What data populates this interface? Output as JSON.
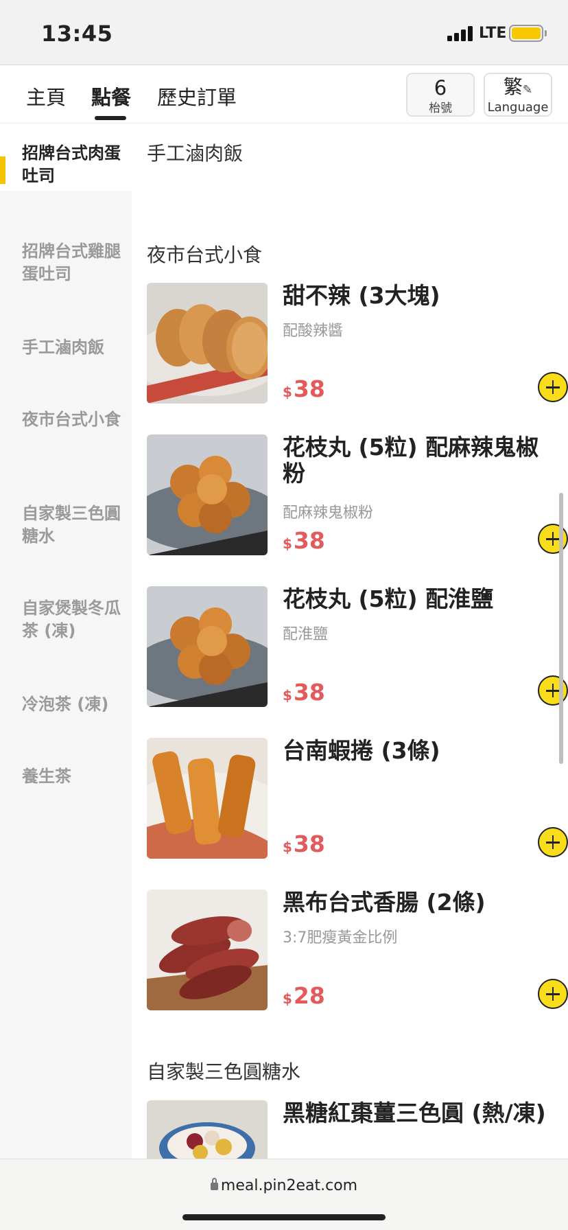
{
  "status_bar": {
    "time": "13:45",
    "network": "LTE"
  },
  "nav": {
    "tabs": [
      "主頁",
      "點餐",
      "歷史訂單"
    ],
    "active_tab": "點餐",
    "table_number": "6",
    "table_label": "枱號",
    "lang_char": "繁",
    "lang_label": "Language"
  },
  "sidebar": {
    "active": "招牌台式肉蛋吐司",
    "items": [
      {
        "label": "招牌台式肉蛋吐司"
      },
      {
        "label": "招牌台式雞腿蛋吐司"
      },
      {
        "label": "手工滷肉飯"
      },
      {
        "label": "夜市台式小食"
      },
      {
        "label": "自家製三色圓糖水"
      },
      {
        "label": "自家煲製冬瓜茶 (凍)"
      },
      {
        "label": "冷泡茶 (凍)"
      },
      {
        "label": "養生茶"
      }
    ]
  },
  "main": {
    "sections": [
      {
        "title": "手工滷肉飯"
      },
      {
        "title": "夜市台式小食"
      },
      {
        "title": "自家製三色圓糖水"
      }
    ],
    "items": [
      {
        "name": "甜不辣 (3大塊)",
        "desc": "配酸辣醬",
        "currency": "$",
        "price": "38",
        "image": "fried-fish-cake-slices"
      },
      {
        "name": "花枝丸 (5粒) 配麻辣鬼椒粉",
        "desc": "配麻辣鬼椒粉",
        "currency": "$",
        "price": "38",
        "image": "fried-cuttlefish-balls"
      },
      {
        "name": "花枝丸 (5粒) 配淮鹽",
        "desc": "配淮鹽",
        "currency": "$",
        "price": "38",
        "image": "fried-cuttlefish-balls"
      },
      {
        "name": "台南蝦捲 (3條)",
        "desc": "",
        "currency": "$",
        "price": "38",
        "image": "fried-shrimp-rolls"
      },
      {
        "name": "黑布台式香腸 (2條)",
        "desc": "3:7肥瘦黃金比例",
        "currency": "$",
        "price": "28",
        "image": "taiwanese-sausages"
      },
      {
        "name": "黑糖紅棗薑三色圓 (熱/凍)",
        "desc": "",
        "currency": "$",
        "price": "",
        "image": "taro-ball-dessert"
      }
    ]
  },
  "url_bar": {
    "url": "meal.pin2eat.com"
  },
  "colors": {
    "accent": "#f5c400",
    "add_button": "#f9dd1a",
    "price": "#e35a5a"
  }
}
